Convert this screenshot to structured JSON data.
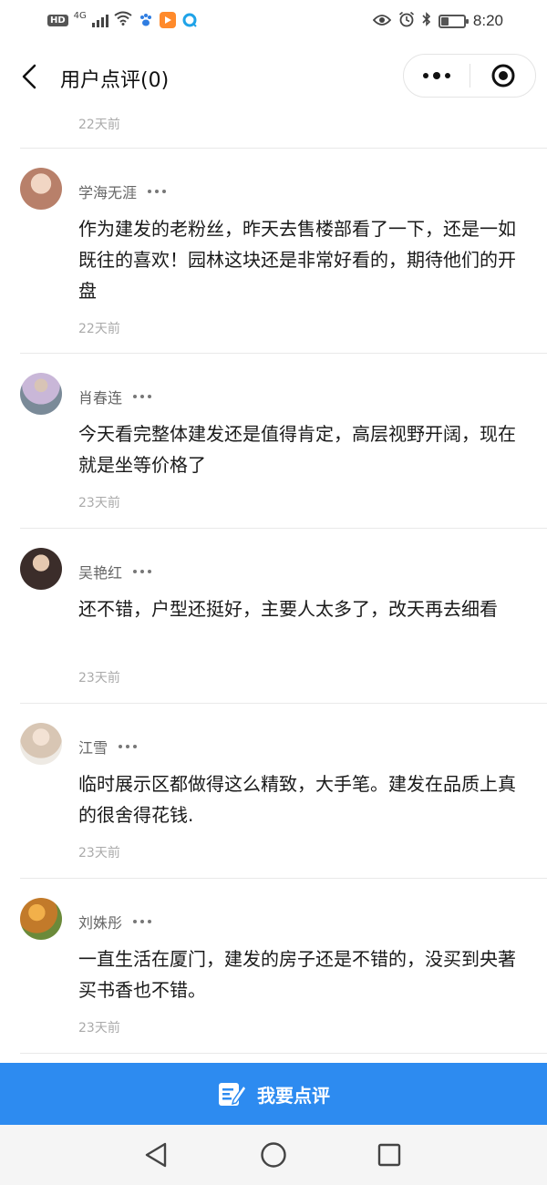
{
  "status_bar": {
    "hd": "HD",
    "network": "4G",
    "time": "8:20",
    "battery_level": 0.3
  },
  "nav": {
    "title": "用户点评(0)"
  },
  "top_stub": {
    "time": "22天前"
  },
  "reviews": [
    {
      "name": "学海无涯",
      "content": "作为建发的老粉丝，昨天去售楼部看了一下，还是一如既往的喜欢！园林这块还是非常好看的，期待他们的开盘",
      "time": "22天前",
      "avatar_color": "#b8806a"
    },
    {
      "name": "肖春连",
      "content": "今天看完整体建发还是值得肯定，高层视野开阔，现在就是坐等价格了",
      "time": "23天前",
      "avatar_color": "#8a9aa8"
    },
    {
      "name": "吴艳红",
      "content": "还不错，户型还挺好，主要人太多了，改天再去细看",
      "time": "23天前",
      "avatar_color": "#4a3a35"
    },
    {
      "name": "江雪",
      "content": "临时展示区都做得这么精致，大手笔。建发在品质上真的很舍得花钱.",
      "time": "23天前",
      "avatar_color": "#e8dccf"
    },
    {
      "name": "刘姝彤",
      "content": "一直生活在厦门，建发的房子还是不错的，没买到央著买书香也不错。",
      "time": "23天前",
      "avatar_color": "#c27a2a"
    }
  ],
  "action": {
    "write_review_label": "我要点评"
  },
  "colors": {
    "accent": "#2d8bf0"
  }
}
